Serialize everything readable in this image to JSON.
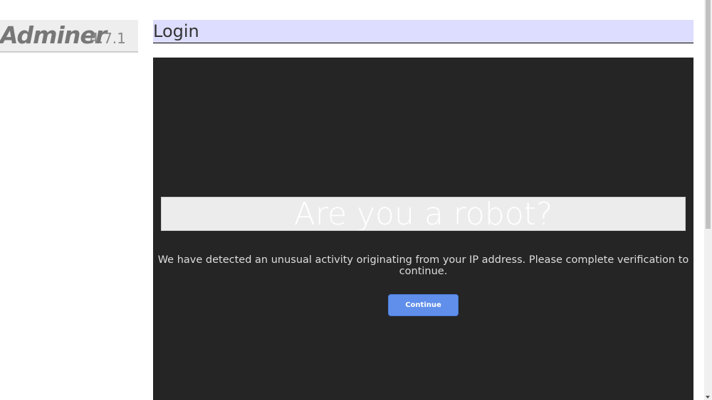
{
  "logo": {
    "name": "Adminer",
    "version": "4.7.1"
  },
  "header": {
    "title": "Login"
  },
  "captcha": {
    "heading": "Are you a robot?",
    "message": "We have detected an unusual activity originating from your IP address. Please complete verification to continue.",
    "button_label": "Continue",
    "button_color": "#5f8fea"
  }
}
